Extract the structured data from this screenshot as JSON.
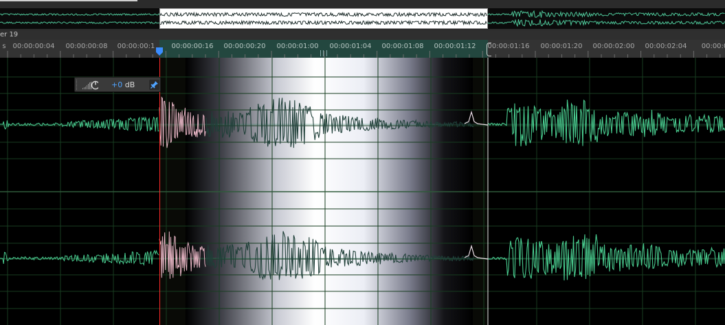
{
  "marker_label": "er 19",
  "ruler": {
    "labels": [
      {
        "text": "s",
        "sel": false
      },
      {
        "text": "00:00:00:04",
        "sel": false
      },
      {
        "text": "00:00:00:08",
        "sel": false
      },
      {
        "text": "00:00:00:1",
        "sel": false
      },
      {
        "text": "00:00:00:16",
        "sel": true
      },
      {
        "text": "00:00:00:20",
        "sel": true
      },
      {
        "text": "00:00:01:00",
        "sel": true
      },
      {
        "text": "00:00:01:04",
        "sel": true
      },
      {
        "text": "00:00:01:08",
        "sel": true
      },
      {
        "text": "00:00:01:12",
        "sel": true
      },
      {
        "text": "00:00:01:16",
        "sel": false
      },
      {
        "text": "00:00:01:20",
        "sel": false
      },
      {
        "text": "00:00:02:00",
        "sel": false
      },
      {
        "text": "00:00:02:04",
        "sel": false
      },
      {
        "text": "00:00:0",
        "sel": false
      }
    ]
  },
  "hud": {
    "gain_value": "+0",
    "gain_unit": " dB",
    "meter_icon": "level-meter-icon",
    "knob_icon": "volume-knob-icon",
    "pin_icon": "pin-icon"
  },
  "colors": {
    "waveform": "#49cc8f",
    "selected_waveform_dark": "#1f3f38",
    "selected_waveform_pink": "#e7b5c4",
    "selection_highlight": "#ffffff",
    "grid": "#173d20",
    "playhead": "#ff2a2a",
    "ruler_selection": "#23473f"
  }
}
